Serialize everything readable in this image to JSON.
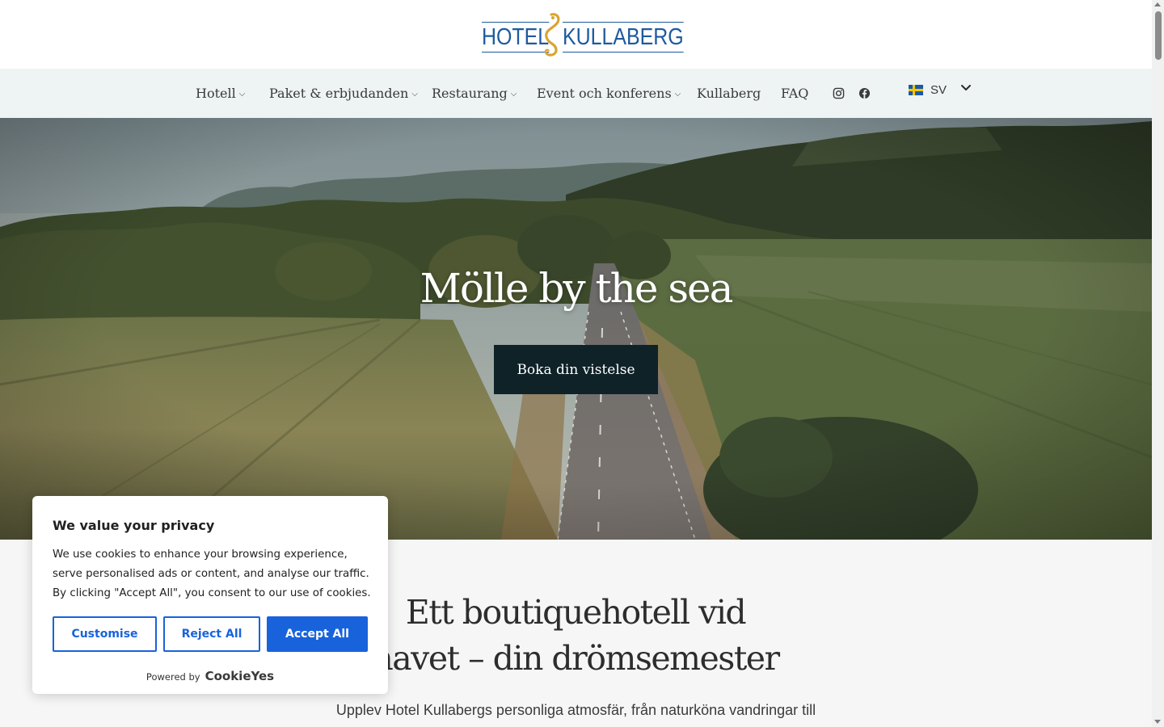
{
  "logo": {
    "left": "HOTEL",
    "right": "KULLABERG"
  },
  "nav": {
    "items": [
      {
        "label": "Hotell",
        "dropdown": true
      },
      {
        "label": "Paket & erbjudanden",
        "dropdown": true
      },
      {
        "label": "Restaurang",
        "dropdown": true
      },
      {
        "label": "Event och konferens",
        "dropdown": true
      },
      {
        "label": "Kullaberg",
        "dropdown": false
      },
      {
        "label": "FAQ",
        "dropdown": false
      }
    ],
    "social": [
      "instagram-icon",
      "facebook-icon"
    ],
    "language": {
      "code": "SV",
      "flag": "sweden-flag-icon"
    }
  },
  "hero": {
    "title": "Mölle by the sea",
    "cta_label": "Boka din vistelse"
  },
  "intro": {
    "heading_line1": "Ett boutiquehotell vid",
    "heading_line2": "havet – din drömsemester",
    "text": "Upplev Hotel Kullabergs personliga atmosfär, från naturköna vandringar till"
  },
  "cookie_banner": {
    "title": "We value your privacy",
    "body": "We use cookies to enhance your browsing experience, serve personalised ads or content, and analyse our traffic. By clicking \"Accept All\", you consent to our use of cookies.",
    "customise_label": "Customise",
    "reject_label": "Reject All",
    "accept_label": "Accept All",
    "powered_by": "Powered by",
    "brand": "CookieYes"
  },
  "colors": {
    "accent": "#1863dc",
    "nav_bg": "#eef3f3",
    "hero_button_bg": "#0f2228",
    "logo_blue": "#1e5a9e",
    "logo_gold": "#d9a531"
  }
}
